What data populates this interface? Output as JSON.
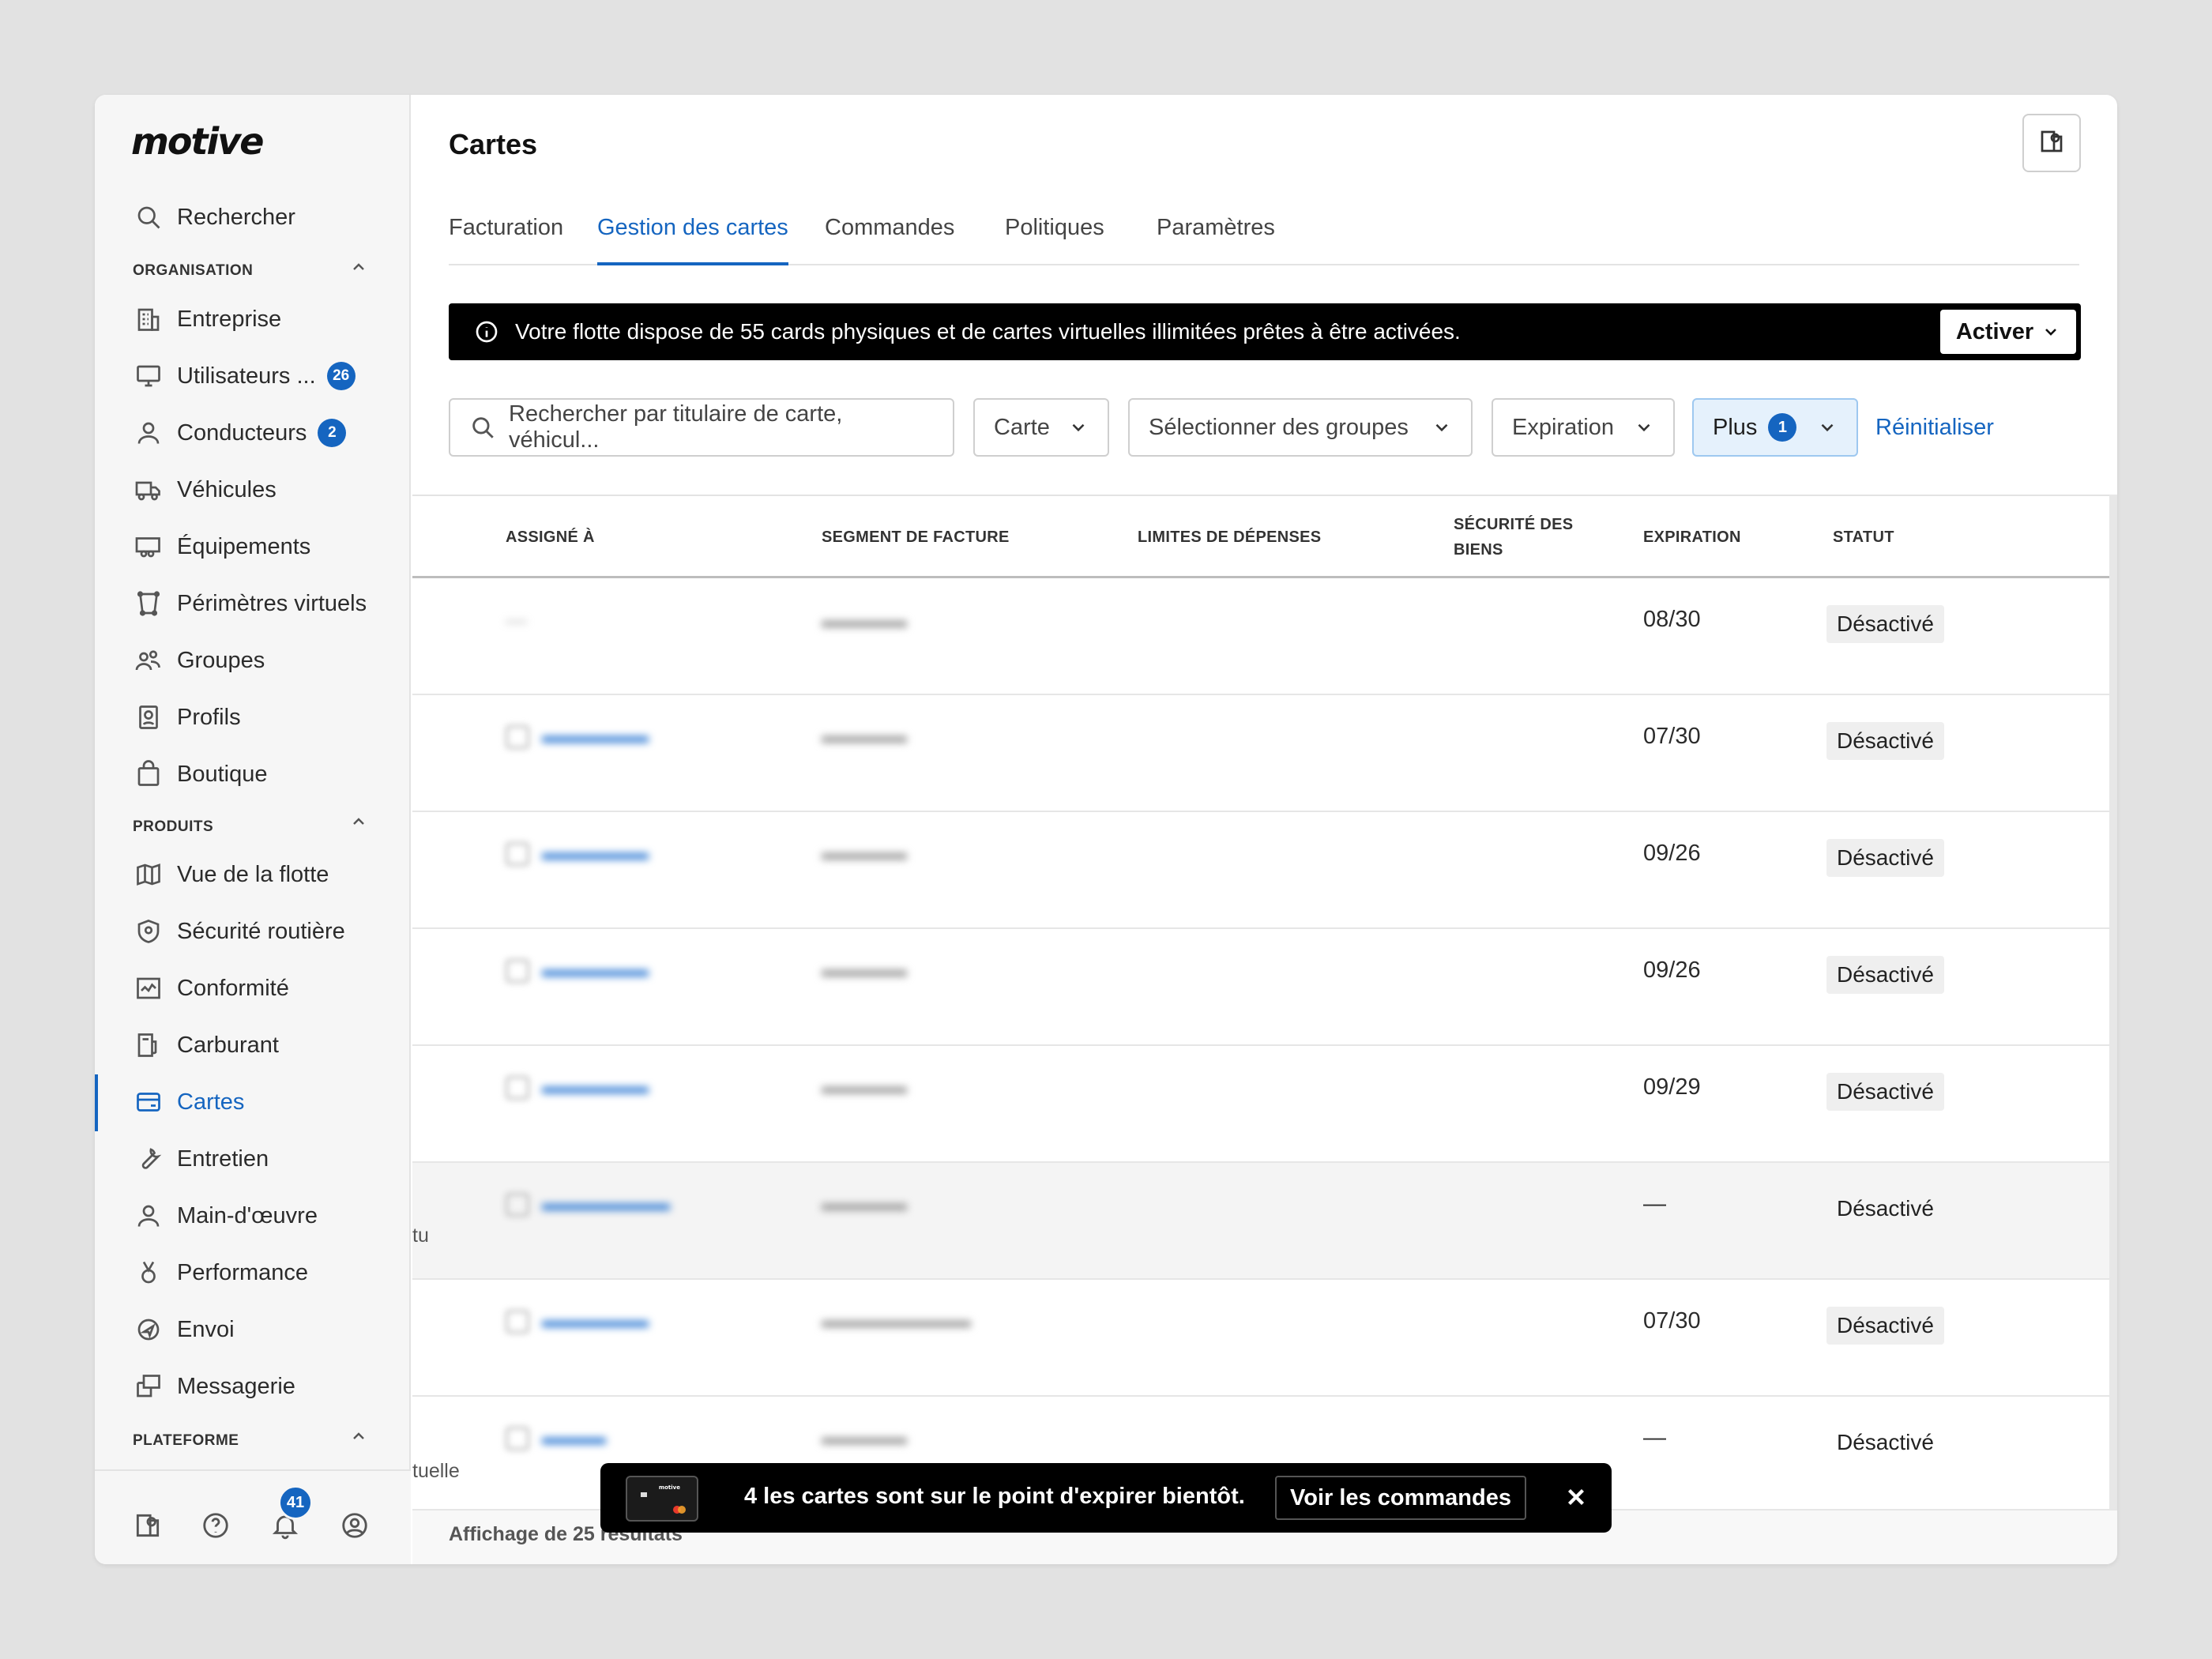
{
  "sidebar": {
    "logo": "motive",
    "search": "Rechercher",
    "org_section": "ORGANISATION",
    "org_items": [
      {
        "label": "Entreprise",
        "icon": "building-icon"
      },
      {
        "label": "Utilisateurs ...",
        "icon": "monitor-icon",
        "badge": "26"
      },
      {
        "label": "Conducteurs",
        "icon": "person-icon",
        "badge": "2"
      },
      {
        "label": "Véhicules",
        "icon": "truck-icon"
      },
      {
        "label": "Équipements",
        "icon": "trailer-icon"
      },
      {
        "label": "Périmètres virtuels",
        "icon": "geofence-icon"
      },
      {
        "label": "Groupes",
        "icon": "group-icon"
      },
      {
        "label": "Profils",
        "icon": "profile-settings-icon"
      },
      {
        "label": "Boutique",
        "icon": "shopping-bag-icon"
      }
    ],
    "products_section": "PRODUITS",
    "product_items": [
      {
        "label": "Vue de la flotte",
        "icon": "map-icon"
      },
      {
        "label": "Sécurité routière",
        "icon": "shield-icon"
      },
      {
        "label": "Conformité",
        "icon": "compliance-icon"
      },
      {
        "label": "Carburant",
        "icon": "fuel-icon"
      },
      {
        "label": "Cartes",
        "icon": "card-icon",
        "active": true
      },
      {
        "label": "Entretien",
        "icon": "wrench-icon"
      },
      {
        "label": "Main-d'œuvre",
        "icon": "worker-icon"
      },
      {
        "label": "Performance",
        "icon": "medal-icon"
      },
      {
        "label": "Envoi",
        "icon": "dispatch-icon"
      },
      {
        "label": "Messagerie",
        "icon": "messages-icon"
      }
    ],
    "platform_section": "PLATEFORME",
    "notification_count": "41",
    "accent": "#1565c0"
  },
  "header": {
    "title": "Cartes",
    "tabs": [
      "Facturation",
      "Gestion des cartes",
      "Commandes",
      "Politiques",
      "Paramètres"
    ],
    "active_tab": "Gestion des cartes"
  },
  "banner": {
    "message": "Votre flotte dispose de 55 cards physiques et de cartes virtuelles illimitées prêtes à être activées.",
    "button": "Activer"
  },
  "filters": {
    "search_placeholder": "Rechercher par titulaire de carte, véhicul...",
    "card": "Carte",
    "groups": "Sélectionner des groupes",
    "expiration": "Expiration",
    "more": "Plus",
    "more_count": "1",
    "reset": "Réinitialiser"
  },
  "table": {
    "columns": [
      "ASSIGNÉ À",
      "SEGMENT DE FACTURE",
      "LIMITES DE DÉPENSES",
      "SÉCURITÉ DES BIENS",
      "EXPIRATION",
      "STATUT"
    ],
    "rows": [
      {
        "expiration": "08/30",
        "status": "Désactivé"
      },
      {
        "expiration": "07/30",
        "status": "Désactivé"
      },
      {
        "expiration": "09/26",
        "status": "Désactivé"
      },
      {
        "expiration": "09/26",
        "status": "Désactivé"
      },
      {
        "expiration": "09/29",
        "status": "Désactivé"
      },
      {
        "expiration": "—",
        "status": "Désactivé"
      },
      {
        "expiration": "07/30",
        "status": "Désactivé"
      },
      {
        "expiration": "—",
        "status": "Désactivé"
      }
    ],
    "row_fragment_1": "tu",
    "row_fragment_2": "tuelle",
    "footer": "Affichage de 25 résultats"
  },
  "toast": {
    "message": "4 les cartes sont sur le point d'expirer bientôt.",
    "button": "Voir les commandes"
  }
}
